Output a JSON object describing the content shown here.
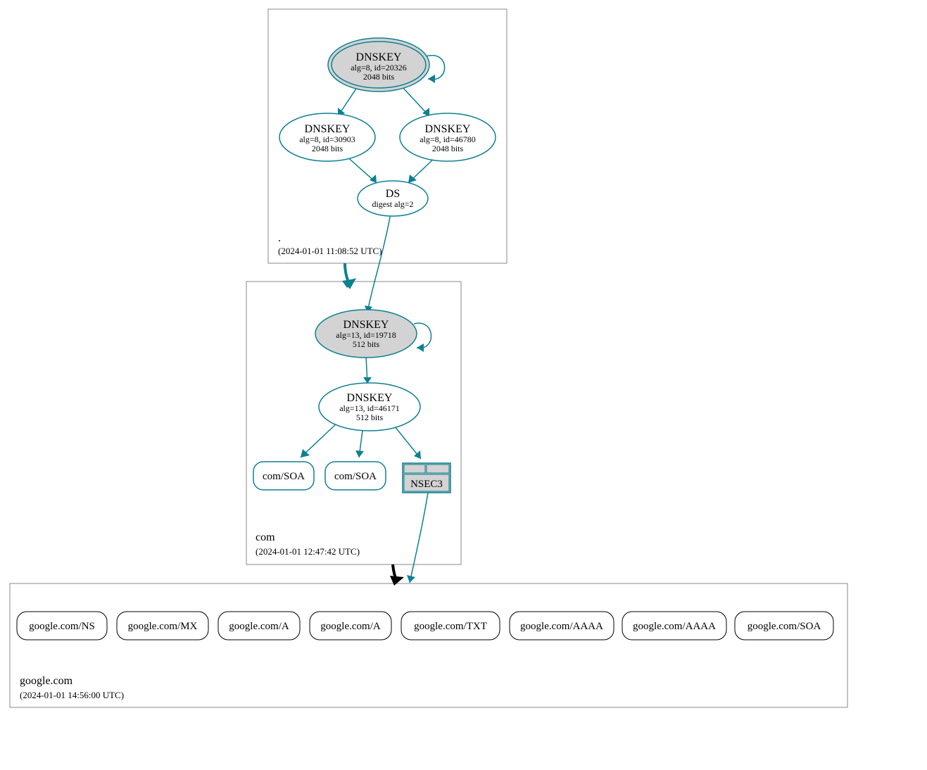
{
  "zones": {
    "root": {
      "name": ".",
      "timestamp": "(2024-01-01 11:08:52 UTC)"
    },
    "com": {
      "name": "com",
      "timestamp": "(2024-01-01 12:47:42 UTC)"
    },
    "google": {
      "name": "google.com",
      "timestamp": "(2024-01-01 14:56:00 UTC)"
    }
  },
  "nodes": {
    "root_ksk": {
      "title": "DNSKEY",
      "sub1": "alg=8, id=20326",
      "sub2": "2048 bits"
    },
    "root_zsk1": {
      "title": "DNSKEY",
      "sub1": "alg=8, id=30903",
      "sub2": "2048 bits"
    },
    "root_zsk2": {
      "title": "DNSKEY",
      "sub1": "alg=8, id=46780",
      "sub2": "2048 bits"
    },
    "root_ds": {
      "title": "DS",
      "sub1": "digest alg=2"
    },
    "com_ksk": {
      "title": "DNSKEY",
      "sub1": "alg=13, id=19718",
      "sub2": "512 bits"
    },
    "com_zsk": {
      "title": "DNSKEY",
      "sub1": "alg=13, id=46171",
      "sub2": "512 bits"
    },
    "com_soa1": {
      "title": "com/SOA"
    },
    "com_soa2": {
      "title": "com/SOA"
    },
    "nsec3": {
      "title": "NSEC3"
    },
    "g_ns": {
      "title": "google.com/NS"
    },
    "g_mx": {
      "title": "google.com/MX"
    },
    "g_a1": {
      "title": "google.com/A"
    },
    "g_a2": {
      "title": "google.com/A"
    },
    "g_txt": {
      "title": "google.com/TXT"
    },
    "g_aaaa1": {
      "title": "google.com/AAAA"
    },
    "g_aaaa2": {
      "title": "google.com/AAAA"
    },
    "g_soa": {
      "title": "google.com/SOA"
    }
  }
}
